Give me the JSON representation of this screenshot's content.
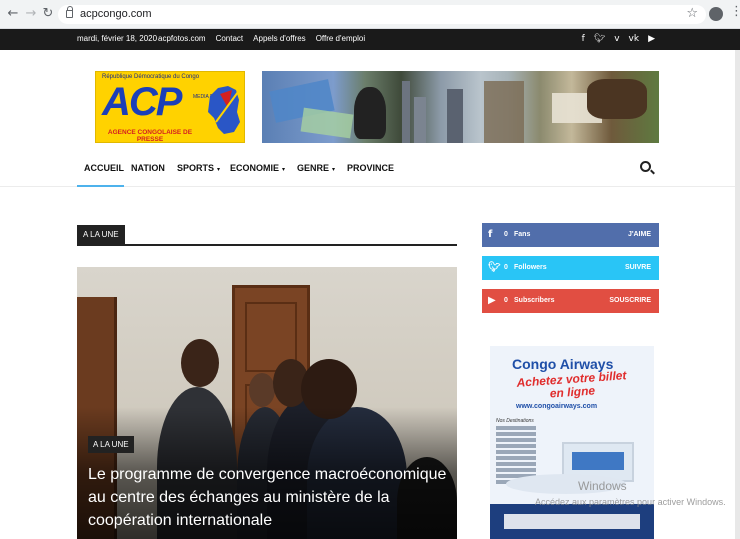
{
  "browser": {
    "url": "acpcongo.com",
    "back_icon": "arrow-left-icon",
    "forward_icon": "arrow-right-icon",
    "reload_icon": "reload-icon",
    "star_icon": "star-icon",
    "profile_icon": "account-circle-icon",
    "menu_icon": "kebab-menu-icon"
  },
  "topbar": {
    "date": "mardi, février 18, 2020",
    "links": [
      "acpfotos.com",
      "Contact",
      "Appels d'offres",
      "Offre d'emploi"
    ],
    "social_icons": [
      "facebook-icon",
      "twitter-icon",
      "vimeo-icon",
      "vk-icon",
      "youtube-icon"
    ]
  },
  "header": {
    "logo": {
      "country": "République Démocratique du Congo",
      "acronym": "ACP",
      "media": "MEDIA PUBLIC",
      "agency": "AGENCE CONGOLAISE DE PRESSE"
    }
  },
  "nav": {
    "items": [
      {
        "label": "ACCUEIL",
        "dropdown": false
      },
      {
        "label": "NATION",
        "dropdown": false
      },
      {
        "label": "SPORTS",
        "dropdown": true
      },
      {
        "label": "ECONOMIE",
        "dropdown": true
      },
      {
        "label": "GENRE",
        "dropdown": true
      },
      {
        "label": "PROVINCE",
        "dropdown": false
      }
    ],
    "active": "ACCUEIL"
  },
  "main": {
    "section_title": "A LA UNE",
    "featured": {
      "category": "A LA UNE",
      "title": "Le programme de convergence macroéconomique au centre des échanges au ministère de la coopération internationale"
    }
  },
  "sidebar": {
    "social": [
      {
        "network": "facebook",
        "count": "0",
        "label": "Fans",
        "action": "J'AIME",
        "color": "#516eab"
      },
      {
        "network": "twitter",
        "count": "0",
        "label": "Followers",
        "action": "SUIVRE",
        "color": "#29c5f6"
      },
      {
        "network": "youtube",
        "count": "0",
        "label": "Subscribers",
        "action": "SOUSCRIRE",
        "color": "#e14e42"
      }
    ],
    "ad": {
      "brand": "Congo Airways",
      "slogan": "Achetez votre billet en ligne",
      "site": "www.congoairways.com",
      "destinations": "Nos Destinations"
    }
  },
  "os_watermark": {
    "line1": "Windows",
    "line2": "Accédez aux paramètres pour activer Windows."
  }
}
